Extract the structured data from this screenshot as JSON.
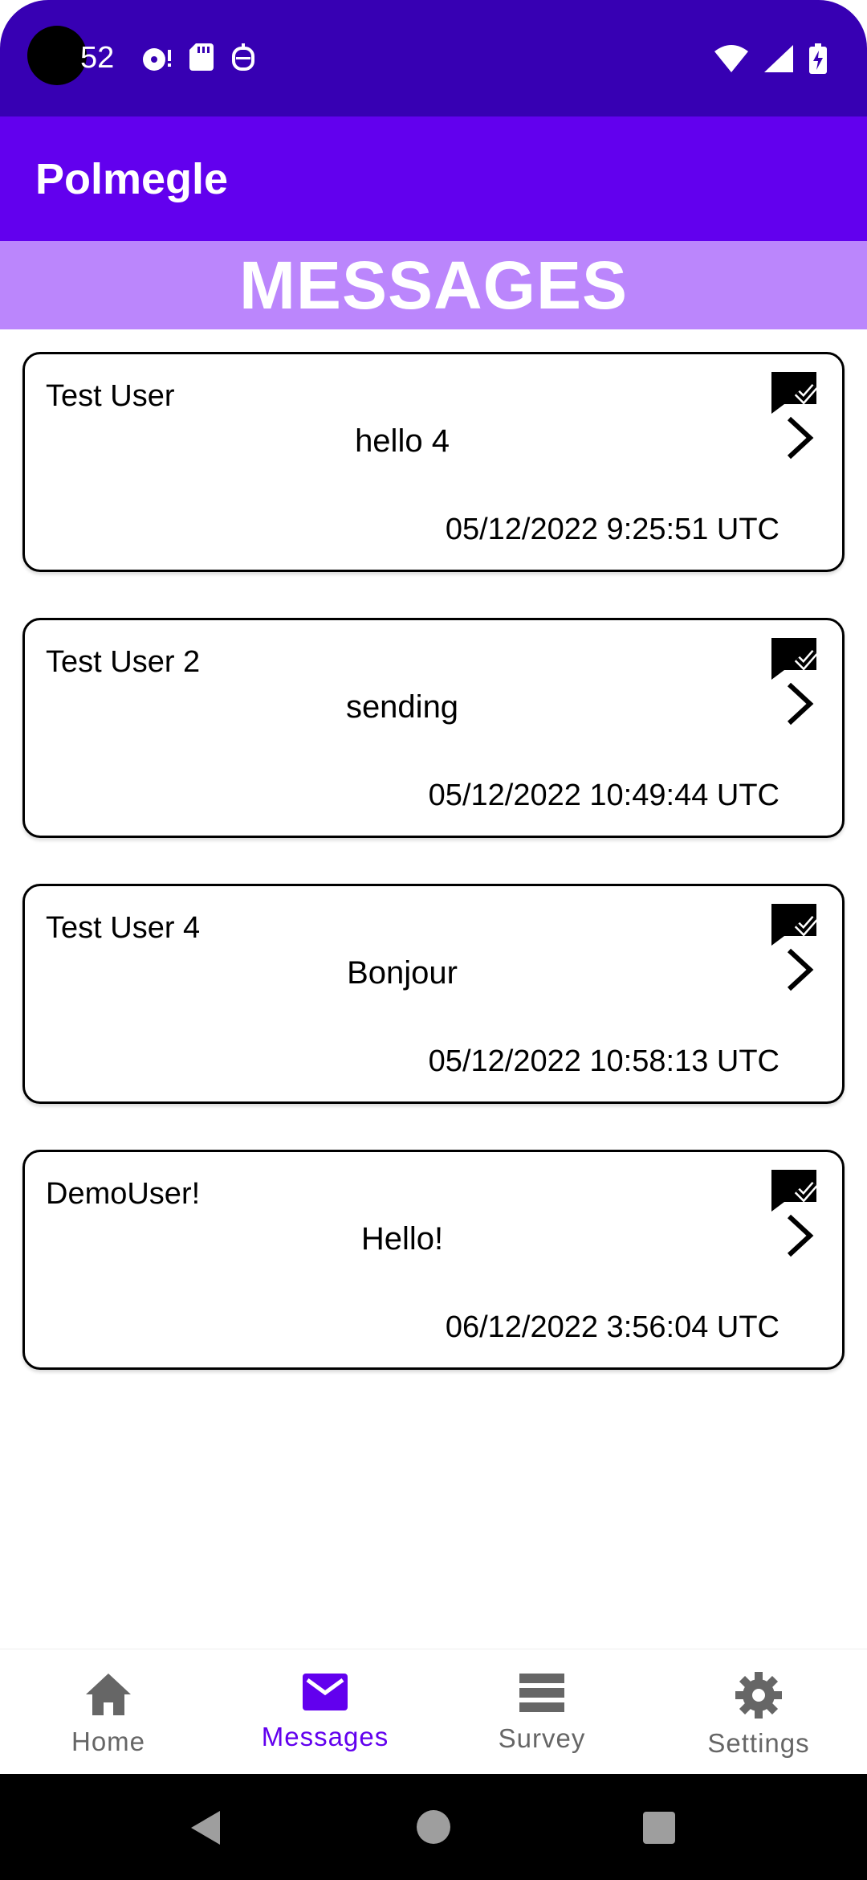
{
  "status_bar": {
    "time": "52",
    "icons_left": [
      "media-icon",
      "sd-card-icon",
      "debug-icon"
    ],
    "icons_right": [
      "wifi-icon",
      "signal-icon",
      "battery-charging-icon"
    ]
  },
  "app_bar": {
    "title": "Polmegle"
  },
  "section": {
    "title": "MESSAGES"
  },
  "messages": [
    {
      "sender": "Test User",
      "text": "hello 4",
      "timestamp": "05/12/2022 9:25:51 UTC"
    },
    {
      "sender": "Test User 2",
      "text": "sending",
      "timestamp": "05/12/2022 10:49:44 UTC"
    },
    {
      "sender": "Test User 4",
      "text": "Bonjour",
      "timestamp": "05/12/2022 10:58:13 UTC"
    },
    {
      "sender": "DemoUser!",
      "text": "Hello!",
      "timestamp": "06/12/2022 3:56:04 UTC"
    }
  ],
  "bottom_nav": {
    "items": [
      {
        "label": "Home",
        "icon": "home-icon"
      },
      {
        "label": "Messages",
        "icon": "mail-icon"
      },
      {
        "label": "Survey",
        "icon": "list-icon"
      },
      {
        "label": "Settings",
        "icon": "gear-icon"
      }
    ],
    "active": "Messages"
  },
  "colors": {
    "status_bar": "#3700B3",
    "app_bar": "#6200EE",
    "section_header": "#BB86FC",
    "nav_active": "#6200EE",
    "nav_inactive": "#666666"
  }
}
